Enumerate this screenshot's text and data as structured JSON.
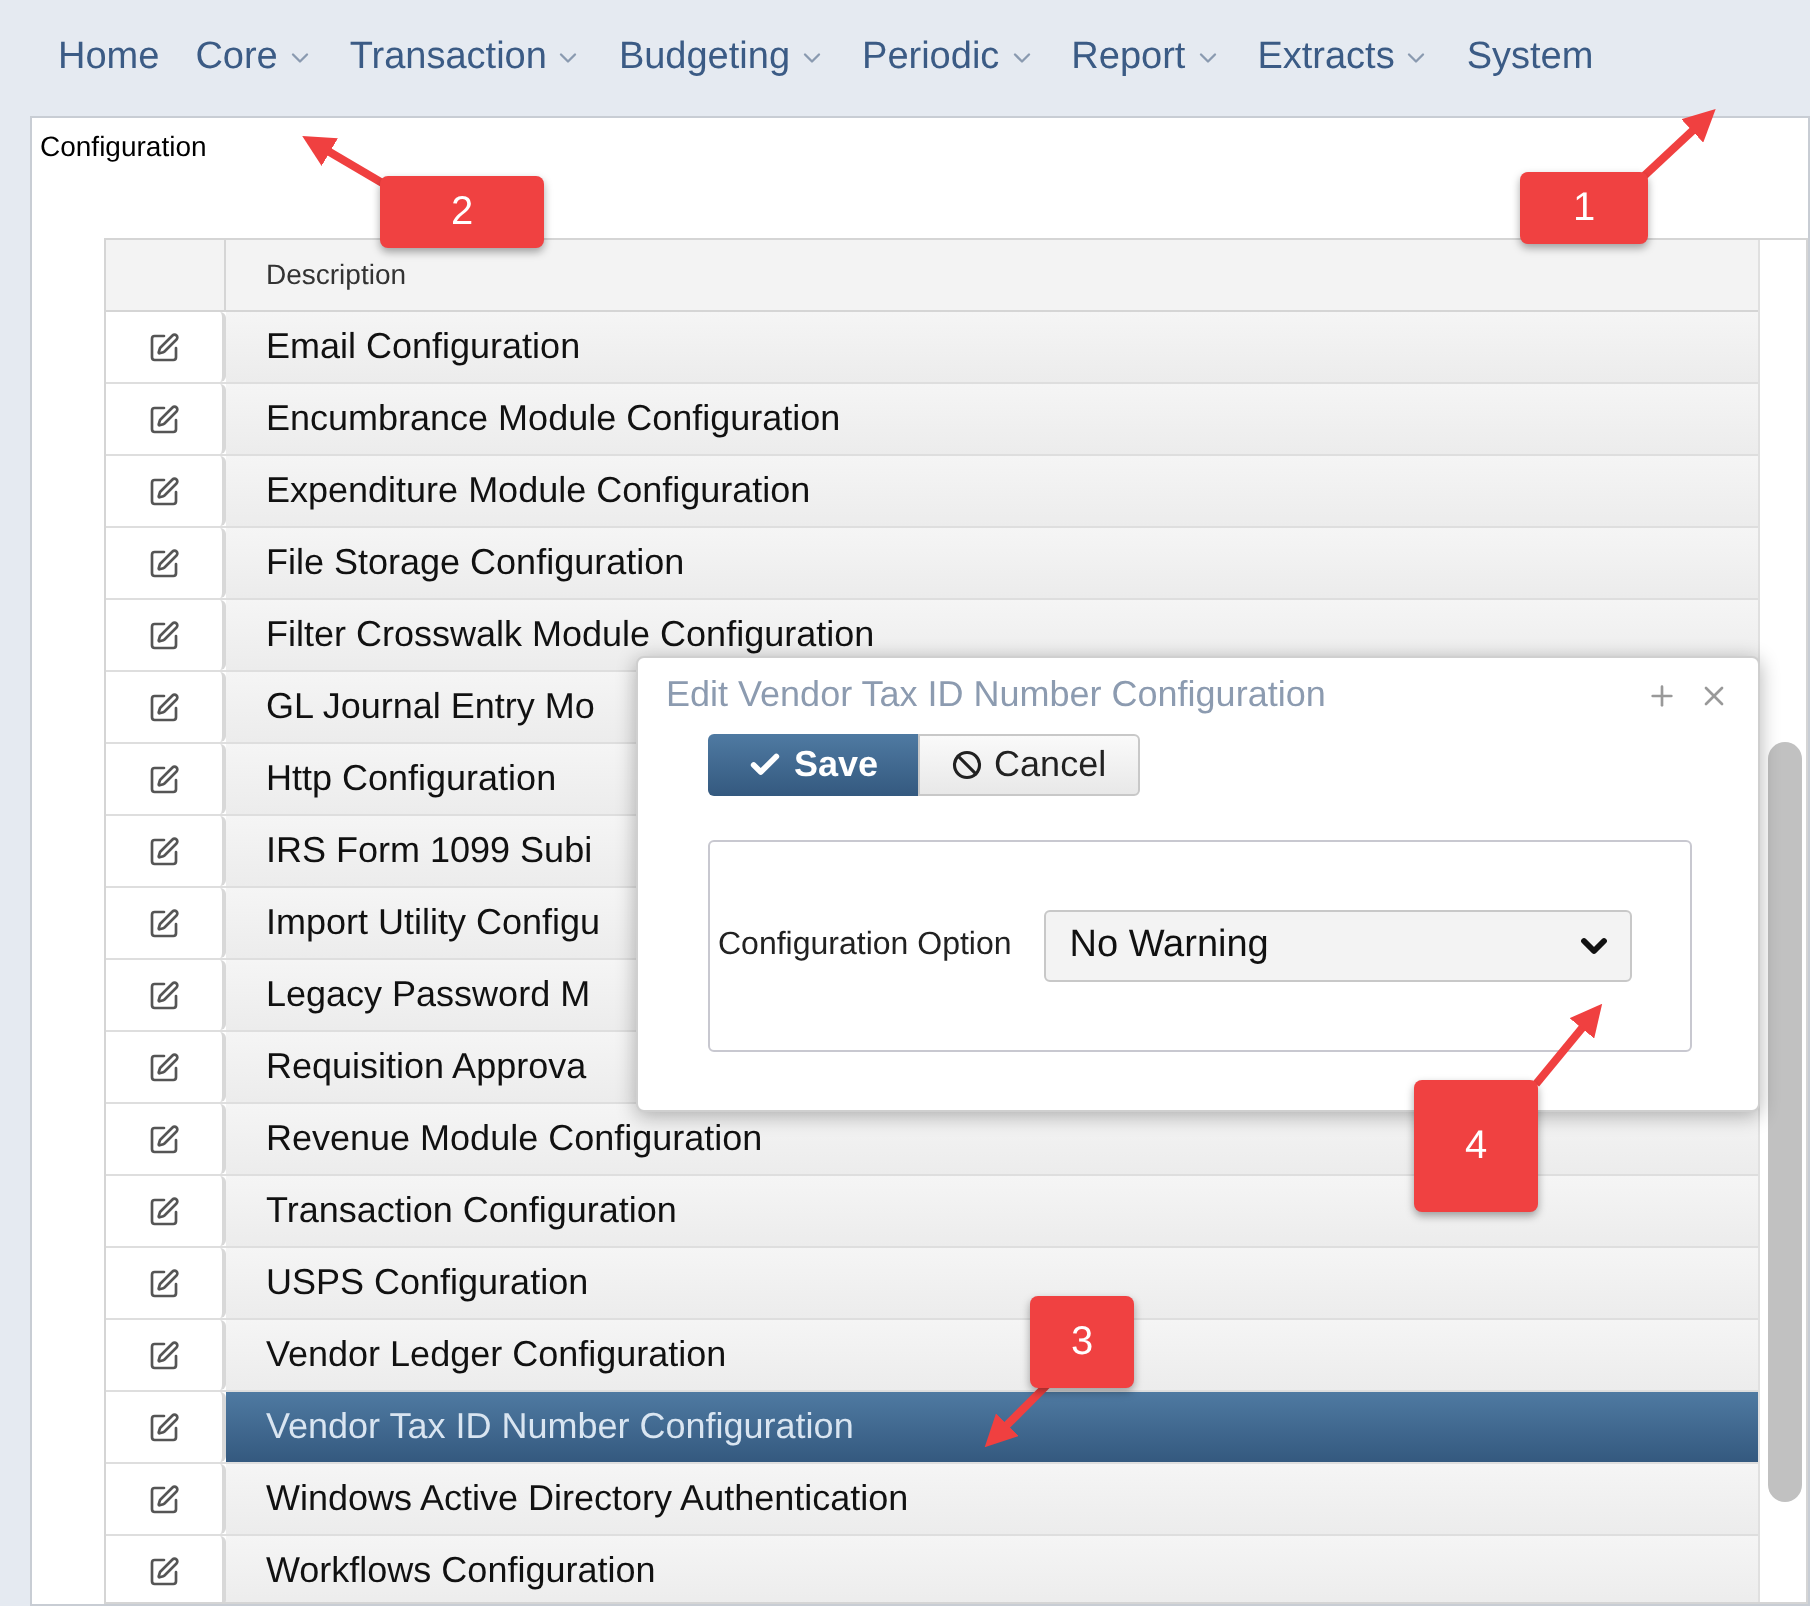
{
  "nav": [
    {
      "label": "Home",
      "dropdown": false
    },
    {
      "label": "Core",
      "dropdown": true
    },
    {
      "label": "Transaction",
      "dropdown": true
    },
    {
      "label": "Budgeting",
      "dropdown": true
    },
    {
      "label": "Periodic",
      "dropdown": true
    },
    {
      "label": "Report",
      "dropdown": true
    },
    {
      "label": "Extracts",
      "dropdown": true
    },
    {
      "label": "System",
      "dropdown": false
    }
  ],
  "page_title": "Configuration",
  "table": {
    "columns": [
      "Description"
    ],
    "rows": [
      {
        "description": "Email Configuration",
        "selected": false
      },
      {
        "description": "Encumbrance Module Configuration",
        "selected": false
      },
      {
        "description": "Expenditure Module Configuration",
        "selected": false
      },
      {
        "description": "File Storage Configuration",
        "selected": false
      },
      {
        "description": "Filter Crosswalk Module Configuration",
        "selected": false
      },
      {
        "description": "GL Journal Entry Mo",
        "selected": false
      },
      {
        "description": "Http Configuration",
        "selected": false
      },
      {
        "description": "IRS Form 1099 Subi",
        "selected": false
      },
      {
        "description": "Import Utility Configu",
        "selected": false
      },
      {
        "description": "Legacy Password M",
        "selected": false
      },
      {
        "description": "Requisition Approva",
        "selected": false
      },
      {
        "description": "Revenue Module Configuration",
        "selected": false
      },
      {
        "description": "Transaction Configuration",
        "selected": false
      },
      {
        "description": "USPS Configuration",
        "selected": false
      },
      {
        "description": "Vendor Ledger Configuration",
        "selected": false
      },
      {
        "description": "Vendor Tax ID Number Configuration",
        "selected": true
      },
      {
        "description": "Windows Active Directory Authentication",
        "selected": false
      },
      {
        "description": "Workflows Configuration",
        "selected": false
      }
    ]
  },
  "dialog": {
    "title": "Edit Vendor Tax ID Number Configuration",
    "buttons": [
      {
        "label": "Save",
        "kind": "primary"
      },
      {
        "label": "Cancel",
        "kind": "secondary"
      }
    ],
    "field_label": "Configuration Option",
    "field_value": "No Warning"
  },
  "callouts": [
    {
      "number": "1"
    },
    {
      "number": "2"
    },
    {
      "number": "3"
    },
    {
      "number": "4"
    }
  ]
}
